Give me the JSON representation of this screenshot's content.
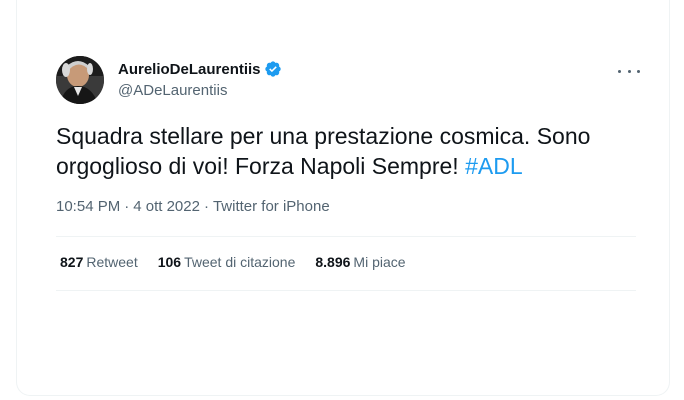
{
  "author": {
    "display_name": "AurelioDeLaurentiis",
    "handle": "@ADeLaurentiis",
    "verified_icon": "verified-badge-icon",
    "verified_color": "#1d9bf0"
  },
  "tweet": {
    "text": "Squadra stellare per una prestazione cosmica. Sono orgoglioso di voi! Forza Napoli Sempre! ",
    "hashtag": "#ADL",
    "time": "10:54 PM",
    "separator": "·",
    "date": "4 ott 2022",
    "source": "Twitter for iPhone"
  },
  "stats": {
    "retweets": {
      "count": "827",
      "label": "Retweet"
    },
    "quotes": {
      "count": "106",
      "label": "Tweet di citazione"
    },
    "likes": {
      "count": "8.896",
      "label": "Mi piace"
    }
  },
  "colors": {
    "text": "#0f1419",
    "secondary": "#536471",
    "link": "#1d9bf0",
    "divider": "#eff3f4"
  }
}
